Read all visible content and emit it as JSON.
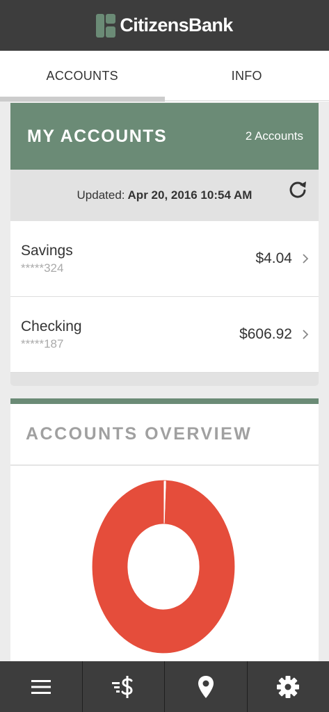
{
  "header": {
    "brand_name": "CitizensBank",
    "logo_icon": "citizens-bank-logo-icon",
    "brand_color": "#6b8b76"
  },
  "tabs": [
    {
      "label": "ACCOUNTS",
      "active": true
    },
    {
      "label": "INFO",
      "active": false
    }
  ],
  "my_accounts": {
    "title": "MY ACCOUNTS",
    "count": "2 Accounts",
    "updated_label": "Updated:",
    "updated_value": "Apr 20, 2016 10:54 AM",
    "refresh_icon": "refresh-icon",
    "accounts": [
      {
        "name": "Savings",
        "number": "*****324",
        "balance": "$4.04"
      },
      {
        "name": "Checking",
        "number": "*****187",
        "balance": "$606.92"
      }
    ]
  },
  "overview": {
    "title": "ACCOUNTS OVERVIEW",
    "colors": {
      "checking": "#e54d3b",
      "savings": "#ffffff"
    }
  },
  "bottom_nav": [
    {
      "icon": "menu-icon"
    },
    {
      "icon": "transfer-money-icon"
    },
    {
      "icon": "location-pin-icon"
    },
    {
      "icon": "gear-icon"
    }
  ],
  "chart_data": {
    "type": "pie",
    "categories": [
      "Savings",
      "Checking"
    ],
    "values": [
      4.04,
      606.92
    ],
    "title": "ACCOUNTS OVERVIEW"
  }
}
